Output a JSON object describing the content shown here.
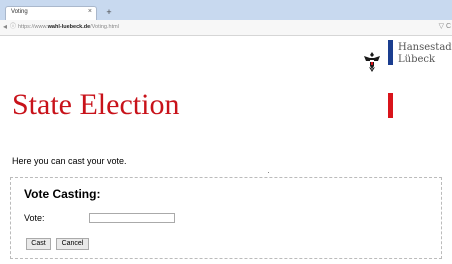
{
  "browser": {
    "tab_title": "Voting",
    "tab_close": "×",
    "new_tab": "+",
    "back": "◂",
    "info": "ⓘ",
    "url_prefix": "https://www.",
    "url_domain": "wahl-luebeck.de",
    "url_path": "/Voting.html",
    "bookmark": "▽",
    "reload": "C"
  },
  "logo": {
    "line1": "Hansestadt",
    "line2": "Lübeck",
    "colors": {
      "blue": "#1a3d8f",
      "red": "#d9141b"
    }
  },
  "page": {
    "title": "State Election",
    "intro": "Here you can cast your vote."
  },
  "form": {
    "legend": "Vote Casting:",
    "vote_label": "Vote:",
    "vote_value": "",
    "cast_label": "Cast",
    "cancel_label": "Cancel"
  }
}
